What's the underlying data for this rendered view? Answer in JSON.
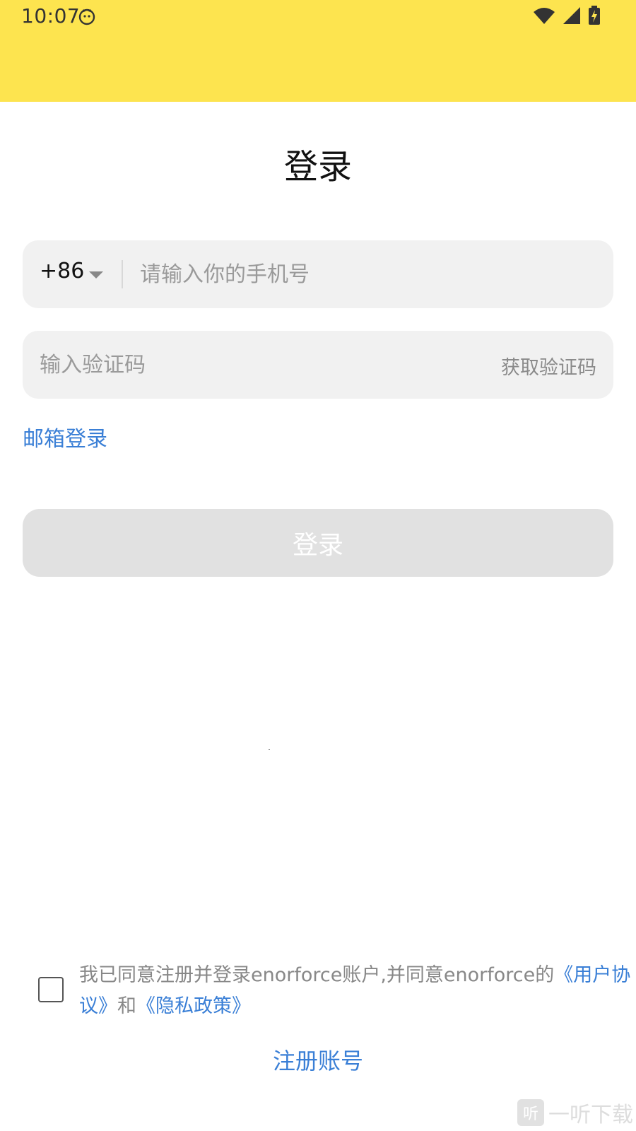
{
  "status_bar": {
    "time": "10:07",
    "background": "#fde44f",
    "icons": [
      "face-icon",
      "wifi-icon",
      "signal-icon",
      "battery-charging-icon"
    ]
  },
  "page": {
    "title": "登录"
  },
  "phone": {
    "country_code": "+86",
    "placeholder": "请输入你的手机号",
    "value": ""
  },
  "code": {
    "placeholder": "输入验证码",
    "value": "",
    "get_code_label": "获取验证码"
  },
  "email_login_label": "邮箱登录",
  "login_button_label": "登录",
  "agreement": {
    "checked": false,
    "prefix": "我已同意注册并登录enorforce账户,并同意enorforce的",
    "user_agreement": "《用户协议》",
    "conjunction": "和",
    "privacy_policy": "《隐私政策》"
  },
  "register_label": "注册账号",
  "watermark": {
    "logo_char": "听",
    "text": "一听下载"
  },
  "colors": {
    "accent": "#3a7fd6",
    "field_bg": "#f1f1f1",
    "button_disabled_bg": "#e1e1e1"
  }
}
